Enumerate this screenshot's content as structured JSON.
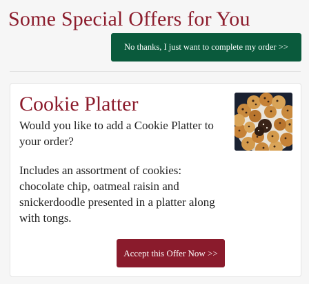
{
  "page": {
    "title": "Some Special Offers for You",
    "decline_label": "No thanks, I just want to complete my order >>"
  },
  "offer": {
    "title": "Cookie Platter",
    "question": "Would you like to add a Cookie Platter to your order?",
    "description": "Includes an assortment of cookies: chocolate chip, oatmeal raisin and snickerdoodle presented in a platter along with tongs.",
    "image_alt": "Cookie Platter",
    "accept_label": "Accept this Offer Now >>"
  },
  "colors": {
    "brand_red": "#8c1c2c",
    "decline_green": "#0a5a3c",
    "background": "#f6f6f6"
  }
}
